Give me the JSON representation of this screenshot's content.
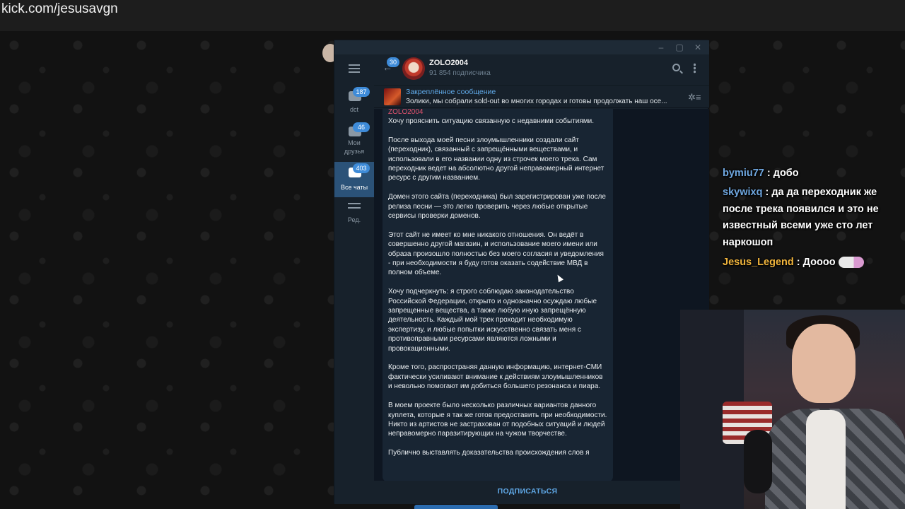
{
  "browser": {
    "url": "kick.com/jesusavgn"
  },
  "sidebar": {
    "folders": [
      {
        "label": "dct",
        "badge": "187"
      },
      {
        "label": "Мои\nдрузья",
        "badge": "46"
      },
      {
        "label": "Все чаты",
        "badge": "403"
      },
      {
        "label": "Ред.",
        "badge": ""
      }
    ]
  },
  "header": {
    "back_badge": "30",
    "channel_name": "ZOLO2004",
    "subscribers": "91 854 подписчика"
  },
  "pinned": {
    "title": "Закреплённое сообщение",
    "text": "Золики, мы собрали sold-out во многих городах и готовы продолжать наш осе..."
  },
  "message": {
    "author": "ZOLO2004",
    "paragraphs": [
      "Хочу прояснить ситуацию связанную с недавними событиями.",
      "После выхода моей песни злоумышленники создали сайт (переходник), связанный с запрещёнными веществами, и использовали в его названии одну из строчек моего трека. Сам переходник ведет на абсолютно другой неправомерный интернет ресурс с другим названием.",
      "Домен этого сайта (переходника) был зарегистрирован уже после релиза песни — это легко проверить через любые открытые сервисы проверки доменов.",
      "Этот сайт не имеет ко мне никакого отношения. Он ведёт в совершенно другой магазин, и использование моего имени или образа произошло полностью без моего согласия и уведомления - при необходимости я буду готов оказать содействие МВД в полном объеме.",
      "Хочу подчеркнуть: я строго соблюдаю законодательство Российской Федерации, открыто и однозначно осуждаю любые запрещенные вещества, а также любую иную запрещённую деятельность. Каждый мой трек проходит необходимую экспертизу, и любые попытки искусственно связать меня с противоправными ресурсами являются ложными и провокационными.",
      "Кроме того, распространяя данную информацию, интернет-СМИ фактически усиливают внимание к действиям злоумышленников и невольно помогают им добиться большего резонанса и пиара.",
      "В моем проекте было несколько различных вариантов данного куплета, которые я так же готов предоставить при необходимости.\nНикто из артистов не застрахован от подобных ситуаций и людей неправомерно паразитирующих на чужом творчестве.",
      "Публично выставлять доказательства происхождения слов я"
    ]
  },
  "subscribe_label": "ПОДПИСАТЬСЯ",
  "stream_chat": [
    {
      "user": "bymiu77",
      "text": "добо"
    },
    {
      "user": "skywixq",
      "text": "да да переходник же"
    },
    {
      "user": "",
      "text": "после трека появился и это не"
    },
    {
      "user": "",
      "text": "известный всеми уже сто лет"
    },
    {
      "user": "",
      "text": "наркошоп"
    },
    {
      "user": "Jesus_Legend",
      "text": "Доооо"
    }
  ],
  "colors": {
    "accent": "#5fa8e6",
    "author": "#e3536e",
    "badge": "#3e8bd8",
    "chat_user": "#6fa7e0",
    "chat_user_gold": "#f0b43c"
  }
}
